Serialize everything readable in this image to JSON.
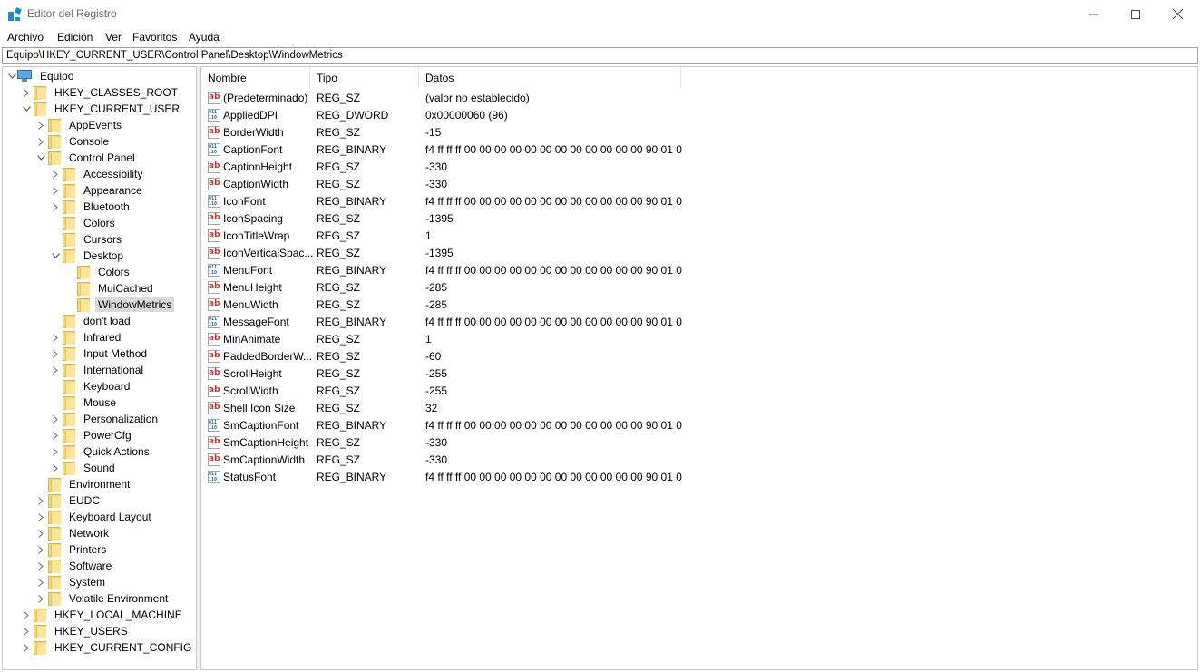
{
  "window": {
    "title": "Editor del Registro",
    "accent": "#1e88d0"
  },
  "menu": [
    "Archivo",
    "Edición",
    "Ver",
    "Favoritos",
    "Ayuda"
  ],
  "address": "Equipo\\HKEY_CURRENT_USER\\Control Panel\\Desktop\\WindowMetrics",
  "tree": [
    {
      "label": "Equipo",
      "level": 0,
      "chevron": "open",
      "icon": "computer-icon"
    },
    {
      "label": "HKEY_CLASSES_ROOT",
      "level": 1,
      "chevron": "closed",
      "icon": "folder-icon"
    },
    {
      "label": "HKEY_CURRENT_USER",
      "level": 1,
      "chevron": "open",
      "icon": "folder-icon"
    },
    {
      "label": "AppEvents",
      "level": 2,
      "chevron": "closed",
      "icon": "folder-icon"
    },
    {
      "label": "Console",
      "level": 2,
      "chevron": "closed",
      "icon": "folder-icon"
    },
    {
      "label": "Control Panel",
      "level": 2,
      "chevron": "open",
      "icon": "folder-icon"
    },
    {
      "label": "Accessibility",
      "level": 3,
      "chevron": "closed",
      "icon": "folder-icon"
    },
    {
      "label": "Appearance",
      "level": 3,
      "chevron": "closed",
      "icon": "folder-icon"
    },
    {
      "label": "Bluetooth",
      "level": 3,
      "chevron": "closed",
      "icon": "folder-icon"
    },
    {
      "label": "Colors",
      "level": 3,
      "chevron": "none",
      "icon": "folder-icon"
    },
    {
      "label": "Cursors",
      "level": 3,
      "chevron": "none",
      "icon": "folder-icon"
    },
    {
      "label": "Desktop",
      "level": 3,
      "chevron": "open",
      "icon": "folder-icon"
    },
    {
      "label": "Colors",
      "level": 4,
      "chevron": "none",
      "icon": "folder-icon"
    },
    {
      "label": "MuiCached",
      "level": 4,
      "chevron": "none",
      "icon": "folder-icon"
    },
    {
      "label": "WindowMetrics",
      "level": 4,
      "chevron": "none",
      "icon": "folder-icon",
      "selected": true
    },
    {
      "label": "don't load",
      "level": 3,
      "chevron": "none",
      "icon": "folder-icon"
    },
    {
      "label": "Infrared",
      "level": 3,
      "chevron": "closed",
      "icon": "folder-icon"
    },
    {
      "label": "Input Method",
      "level": 3,
      "chevron": "closed",
      "icon": "folder-icon"
    },
    {
      "label": "International",
      "level": 3,
      "chevron": "closed",
      "icon": "folder-icon"
    },
    {
      "label": "Keyboard",
      "level": 3,
      "chevron": "none",
      "icon": "folder-icon"
    },
    {
      "label": "Mouse",
      "level": 3,
      "chevron": "none",
      "icon": "folder-icon"
    },
    {
      "label": "Personalization",
      "level": 3,
      "chevron": "closed",
      "icon": "folder-icon"
    },
    {
      "label": "PowerCfg",
      "level": 3,
      "chevron": "closed",
      "icon": "folder-icon"
    },
    {
      "label": "Quick Actions",
      "level": 3,
      "chevron": "closed",
      "icon": "folder-icon"
    },
    {
      "label": "Sound",
      "level": 3,
      "chevron": "closed",
      "icon": "folder-icon"
    },
    {
      "label": "Environment",
      "level": 2,
      "chevron": "none",
      "icon": "folder-icon"
    },
    {
      "label": "EUDC",
      "level": 2,
      "chevron": "closed",
      "icon": "folder-icon"
    },
    {
      "label": "Keyboard Layout",
      "level": 2,
      "chevron": "closed",
      "icon": "folder-icon"
    },
    {
      "label": "Network",
      "level": 2,
      "chevron": "closed",
      "icon": "folder-icon"
    },
    {
      "label": "Printers",
      "level": 2,
      "chevron": "closed",
      "icon": "folder-icon"
    },
    {
      "label": "Software",
      "level": 2,
      "chevron": "closed",
      "icon": "folder-icon"
    },
    {
      "label": "System",
      "level": 2,
      "chevron": "closed",
      "icon": "folder-icon"
    },
    {
      "label": "Volatile Environment",
      "level": 2,
      "chevron": "closed",
      "icon": "folder-icon"
    },
    {
      "label": "HKEY_LOCAL_MACHINE",
      "level": 1,
      "chevron": "closed",
      "icon": "folder-icon"
    },
    {
      "label": "HKEY_USERS",
      "level": 1,
      "chevron": "closed",
      "icon": "folder-icon"
    },
    {
      "label": "HKEY_CURRENT_CONFIG",
      "level": 1,
      "chevron": "closed",
      "icon": "folder-icon"
    }
  ],
  "columns": [
    "Nombre",
    "Tipo",
    "Datos"
  ],
  "values": [
    {
      "name": "(Predeterminado)",
      "type": "REG_SZ",
      "data": "(valor no establecido)",
      "icon": "string-value-icon"
    },
    {
      "name": "AppliedDPI",
      "type": "REG_DWORD",
      "data": "0x00000060 (96)",
      "icon": "binary-value-icon"
    },
    {
      "name": "BorderWidth",
      "type": "REG_SZ",
      "data": "-15",
      "icon": "string-value-icon"
    },
    {
      "name": "CaptionFont",
      "type": "REG_BINARY",
      "data": "f4 ff ff ff 00 00 00 00 00 00 00 00 00 00 00 00 90 01 0...",
      "icon": "binary-value-icon"
    },
    {
      "name": "CaptionHeight",
      "type": "REG_SZ",
      "data": "-330",
      "icon": "string-value-icon"
    },
    {
      "name": "CaptionWidth",
      "type": "REG_SZ",
      "data": "-330",
      "icon": "string-value-icon"
    },
    {
      "name": "IconFont",
      "type": "REG_BINARY",
      "data": "f4 ff ff ff 00 00 00 00 00 00 00 00 00 00 00 00 90 01 0...",
      "icon": "binary-value-icon"
    },
    {
      "name": "IconSpacing",
      "type": "REG_SZ",
      "data": "-1395",
      "icon": "string-value-icon"
    },
    {
      "name": "IconTitleWrap",
      "type": "REG_SZ",
      "data": "1",
      "icon": "string-value-icon"
    },
    {
      "name": "IconVerticalSpac...",
      "type": "REG_SZ",
      "data": "-1395",
      "icon": "string-value-icon"
    },
    {
      "name": "MenuFont",
      "type": "REG_BINARY",
      "data": "f4 ff ff ff 00 00 00 00 00 00 00 00 00 00 00 00 90 01 0...",
      "icon": "binary-value-icon"
    },
    {
      "name": "MenuHeight",
      "type": "REG_SZ",
      "data": "-285",
      "icon": "string-value-icon"
    },
    {
      "name": "MenuWidth",
      "type": "REG_SZ",
      "data": "-285",
      "icon": "string-value-icon"
    },
    {
      "name": "MessageFont",
      "type": "REG_BINARY",
      "data": "f4 ff ff ff 00 00 00 00 00 00 00 00 00 00 00 00 90 01 0...",
      "icon": "binary-value-icon"
    },
    {
      "name": "MinAnimate",
      "type": "REG_SZ",
      "data": "1",
      "icon": "string-value-icon"
    },
    {
      "name": "PaddedBorderW...",
      "type": "REG_SZ",
      "data": "-60",
      "icon": "string-value-icon"
    },
    {
      "name": "ScrollHeight",
      "type": "REG_SZ",
      "data": "-255",
      "icon": "string-value-icon"
    },
    {
      "name": "ScrollWidth",
      "type": "REG_SZ",
      "data": "-255",
      "icon": "string-value-icon"
    },
    {
      "name": "Shell Icon Size",
      "type": "REG_SZ",
      "data": "32",
      "icon": "string-value-icon"
    },
    {
      "name": "SmCaptionFont",
      "type": "REG_BINARY",
      "data": "f4 ff ff ff 00 00 00 00 00 00 00 00 00 00 00 00 90 01 0...",
      "icon": "binary-value-icon"
    },
    {
      "name": "SmCaptionHeight",
      "type": "REG_SZ",
      "data": "-330",
      "icon": "string-value-icon"
    },
    {
      "name": "SmCaptionWidth",
      "type": "REG_SZ",
      "data": "-330",
      "icon": "string-value-icon"
    },
    {
      "name": "StatusFont",
      "type": "REG_BINARY",
      "data": "f4 ff ff ff 00 00 00 00 00 00 00 00 00 00 00 00 90 01 0...",
      "icon": "binary-value-icon"
    }
  ]
}
